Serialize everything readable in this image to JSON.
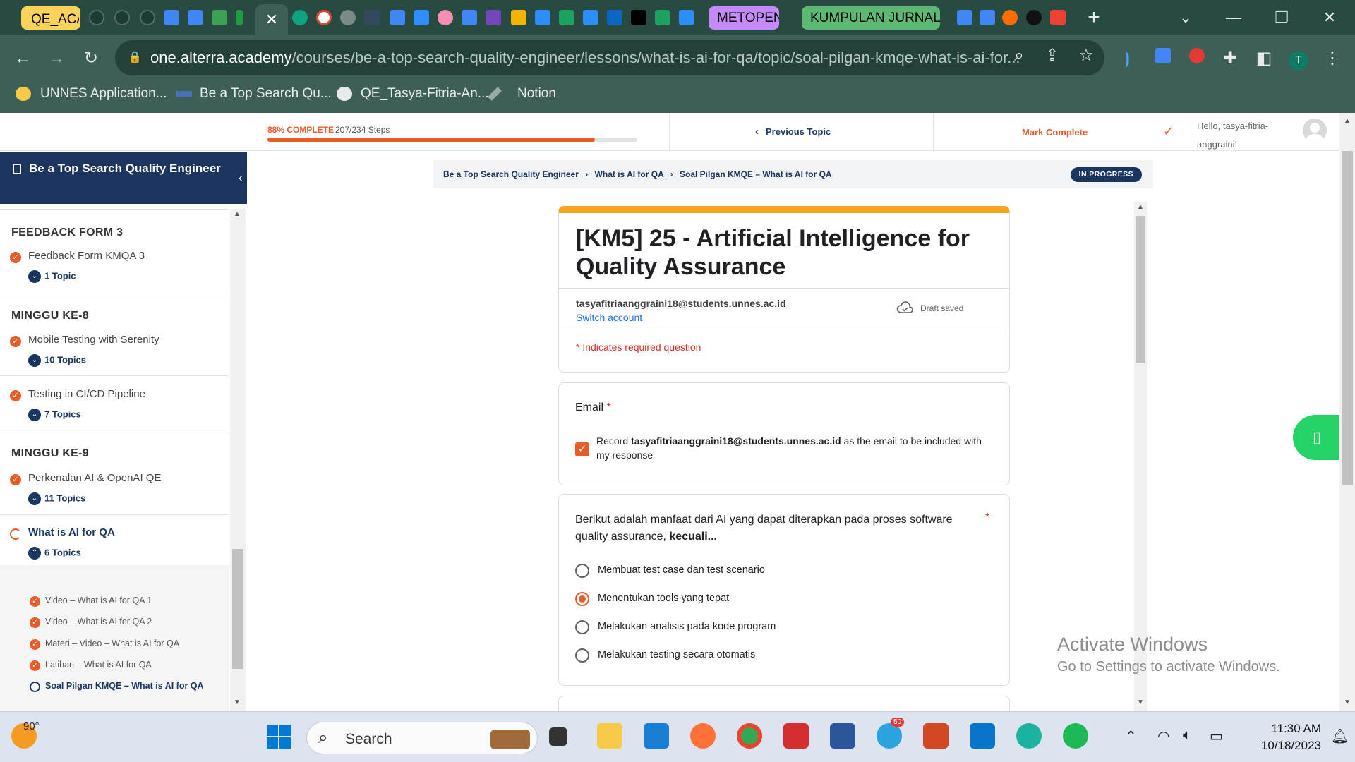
{
  "browser": {
    "tab_groups": [
      {
        "label": "QE_ACA",
        "bg": "#fcd35a",
        "color": "#000"
      },
      {
        "label": "METOPEN",
        "bg": "#c58af9",
        "color": "#000"
      },
      {
        "label": "KUMPULAN JURNAL D",
        "bg": "#5bb974",
        "color": "#000"
      }
    ],
    "active_tab_close": "✕",
    "new_tab": "+",
    "url_host": "one.alterra.academy",
    "url_path": "/courses/be-a-top-search-quality-engineer/lessons/what-is-ai-for-qa/topic/soal-pilgan-kmqe-what-is-ai-for...",
    "profile_initial": "T",
    "bookmarks": [
      "UNNES Application...",
      "Be a Top Search Qu...",
      "QE_Tasya-Fitria-An...",
      "Notion"
    ]
  },
  "progress": {
    "percent_label": "88% COMPLETE",
    "steps_label": "207/234 Steps",
    "fraction": 0.885
  },
  "nav": {
    "previous_topic": "Previous Topic",
    "mark_complete": "Mark Complete",
    "hello": "Hello, tasya-fitria-anggraini!"
  },
  "sidebar": {
    "course_title": "Be a Top Search Quality Engineer",
    "sections": [
      {
        "title": "FEEDBACK FORM 3",
        "lessons": [
          {
            "name": "Feedback Form KMQA 3",
            "topics": "1 Topic"
          }
        ]
      },
      {
        "title": "MINGGU KE-8",
        "lessons": [
          {
            "name": "Mobile Testing with Serenity",
            "topics": "10 Topics"
          },
          {
            "name": "Testing in CI/CD Pipeline",
            "topics": "7 Topics"
          }
        ]
      },
      {
        "title": "MINGGU KE-9",
        "lessons": [
          {
            "name": "Perkenalan AI & OpenAI QE",
            "topics": "11 Topics"
          },
          {
            "name": "What is AI for QA",
            "topics": "6 Topics"
          }
        ]
      }
    ],
    "sub_items": [
      "Video – What is AI for QA 1",
      "Video – What is AI for QA 2",
      "Materi – Video – What is AI for QA",
      "Latihan – What is AI for QA",
      "Soal Pilgan KMQE – What is AI for QA"
    ]
  },
  "breadcrumb": {
    "items": [
      "Be a Top Search Quality Engineer",
      "What is AI for QA",
      "Soal Pilgan KMQE – What is AI for QA"
    ],
    "status": "IN PROGRESS"
  },
  "form": {
    "title": "[KM5] 25 - Artificial Intelligence for Quality Assurance",
    "account_email": "tasyafitriaanggraini18@students.unnes.ac.id",
    "switch_account": "Switch account",
    "draft_status": "Draft saved",
    "required_note": "* Indicates required question",
    "email_label": "Email",
    "record_prefix": "Record ",
    "record_email": "tasyafitriaanggraini18@students.unnes.ac.id",
    "record_suffix": " as the email to be included with my response",
    "question1": {
      "text": "Berikut adalah manfaat dari AI yang dapat diterapkan pada proses software quality assurance, ",
      "emphasis": "kecuali...",
      "options": [
        "Membuat test case dan test scenario",
        "Menentukan tools yang tepat",
        "Melakukan analisis pada kode program",
        "Melakukan testing secara otomatis"
      ],
      "selected_index": 1
    }
  },
  "watermark": {
    "line1": "Activate Windows",
    "line2": "Go to Settings to activate Windows."
  },
  "taskbar": {
    "temperature": "90°",
    "search_placeholder": "Search",
    "time": "11:30 AM",
    "date": "10/18/2023",
    "telegram_badge": "50"
  },
  "colors": {
    "accent": "#e85c2a",
    "navy": "#1a3660",
    "form_header": "#f9a51b"
  }
}
